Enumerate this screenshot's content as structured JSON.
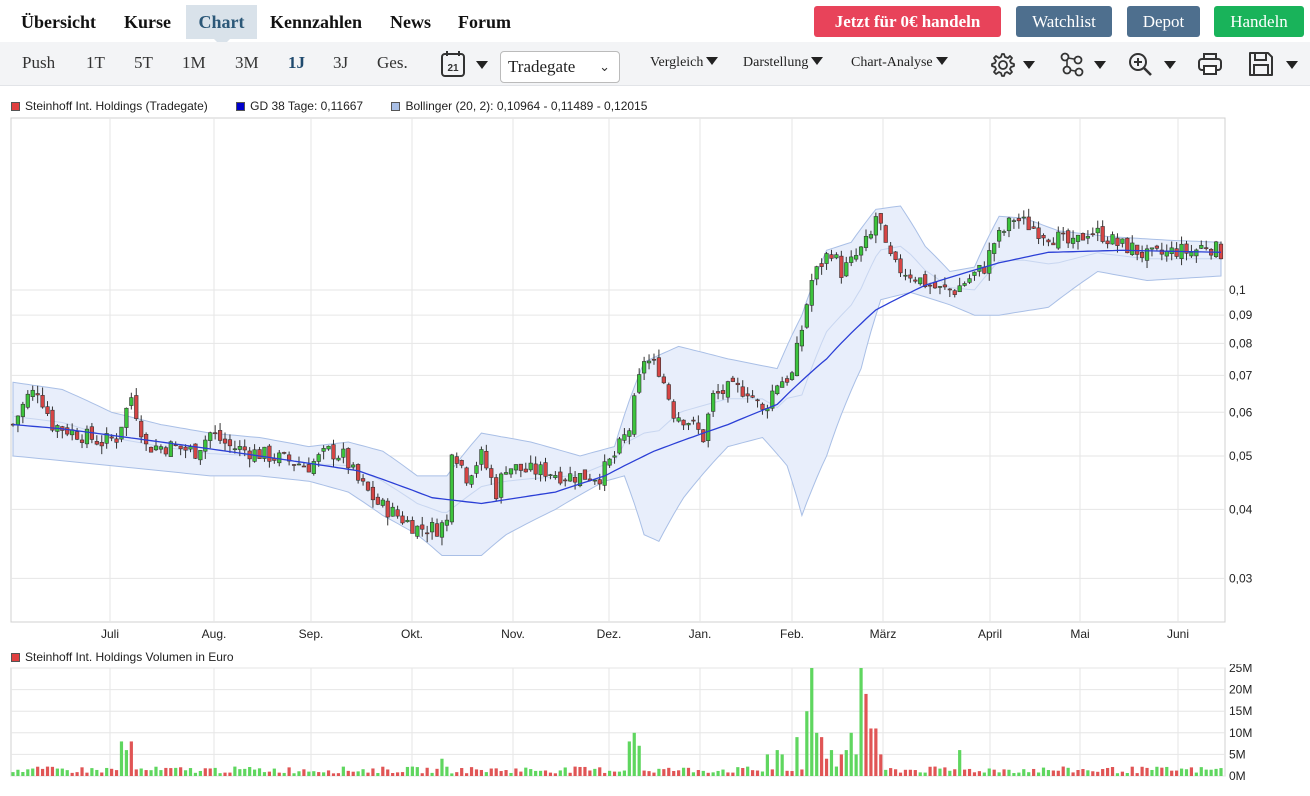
{
  "nav": {
    "tabs": [
      {
        "label": "Übersicht",
        "active": false
      },
      {
        "label": "Kurse",
        "active": false
      },
      {
        "label": "Chart",
        "active": true
      },
      {
        "label": "Kennzahlen",
        "active": false
      },
      {
        "label": "News",
        "active": false
      },
      {
        "label": "Forum",
        "active": false
      }
    ],
    "buttons": {
      "trade_now": "Jetzt für 0€ handeln",
      "watchlist": "Watchlist",
      "depot": "Depot",
      "handeln": "Handeln"
    }
  },
  "toolbar": {
    "timeframes": [
      {
        "label": "Push",
        "active": false
      },
      {
        "label": "1T",
        "active": false
      },
      {
        "label": "5T",
        "active": false
      },
      {
        "label": "1M",
        "active": false
      },
      {
        "label": "3M",
        "active": false
      },
      {
        "label": "1J",
        "active": true
      },
      {
        "label": "3J",
        "active": false
      },
      {
        "label": "Ges.",
        "active": false
      }
    ],
    "calendar_day": "21",
    "exchange_select": "Tradegate",
    "menus": {
      "compare": "Vergleich",
      "display": "Darstellung",
      "analysis": "Chart-Analyse"
    },
    "icons": [
      "calendar-icon",
      "settings-icon",
      "indicators-icon",
      "zoom-in-icon",
      "print-icon",
      "save-icon"
    ]
  },
  "legend_price": [
    {
      "label": "Steinhoff Int. Holdings (Tradegate)",
      "color": "#e04040"
    },
    {
      "label": "GD 38 Tage: 0,11667",
      "color": "#0000cc"
    },
    {
      "label": "Bollinger (20, 2): 0,10964 - 0,11489 - 0,12015",
      "color": "#a9bfe6"
    }
  ],
  "legend_volume": {
    "label": "Steinhoff Int. Holdings Volumen in Euro",
    "color": "#e04040"
  },
  "chart_data": [
    {
      "type": "candlestick",
      "scale": "log",
      "x_ticks": [
        "Juli",
        "Aug.",
        "Sep.",
        "Okt.",
        "Nov.",
        "Dez.",
        "Jan.",
        "Feb.",
        "März",
        "April",
        "Mai",
        "Juni"
      ],
      "y_ticks": [
        "0,03",
        "0,04",
        "0,05",
        "0,06",
        "0,07",
        "0,08",
        "0,09",
        "0,1"
      ],
      "y_tick_values": [
        0.03,
        0.04,
        0.05,
        0.06,
        0.07,
        0.08,
        0.09,
        0.1
      ],
      "ylim": [
        0.025,
        0.205
      ],
      "start_month": "Juni",
      "close_path": [
        [
          0,
          0.057
        ],
        [
          3,
          0.064
        ],
        [
          5,
          0.066
        ],
        [
          8,
          0.057
        ],
        [
          13,
          0.055
        ],
        [
          18,
          0.053
        ],
        [
          21,
          0.054
        ],
        [
          24,
          0.064
        ],
        [
          27,
          0.052
        ],
        [
          32,
          0.052
        ],
        [
          37,
          0.051
        ],
        [
          40,
          0.055
        ],
        [
          44,
          0.052
        ],
        [
          48,
          0.051
        ],
        [
          52,
          0.05
        ],
        [
          56,
          0.049
        ],
        [
          60,
          0.048
        ],
        [
          64,
          0.051
        ],
        [
          67,
          0.05
        ],
        [
          70,
          0.045
        ],
        [
          74,
          0.041
        ],
        [
          78,
          0.039
        ],
        [
          82,
          0.037
        ],
        [
          86,
          0.037
        ],
        [
          88,
          0.038
        ],
        [
          89,
          0.052
        ],
        [
          92,
          0.046
        ],
        [
          95,
          0.05
        ],
        [
          98,
          0.043
        ],
        [
          100,
          0.048
        ],
        [
          104,
          0.047
        ],
        [
          108,
          0.047
        ],
        [
          112,
          0.046
        ],
        [
          116,
          0.046
        ],
        [
          119,
          0.046
        ],
        [
          122,
          0.05
        ],
        [
          125,
          0.056
        ],
        [
          128,
          0.075
        ],
        [
          131,
          0.072
        ],
        [
          134,
          0.06
        ],
        [
          137,
          0.058
        ],
        [
          140,
          0.054
        ],
        [
          142,
          0.064
        ],
        [
          145,
          0.066
        ],
        [
          149,
          0.066
        ],
        [
          152,
          0.06
        ],
        [
          155,
          0.068
        ],
        [
          158,
          0.07
        ],
        [
          160,
          0.085
        ],
        [
          162,
          0.104
        ],
        [
          164,
          0.112
        ],
        [
          166,
          0.118
        ],
        [
          168,
          0.108
        ],
        [
          170,
          0.112
        ],
        [
          172,
          0.118
        ],
        [
          174,
          0.125
        ],
        [
          175,
          0.136
        ],
        [
          176,
          0.13
        ],
        [
          177,
          0.118
        ],
        [
          179,
          0.11
        ],
        [
          182,
          0.107
        ],
        [
          185,
          0.103
        ],
        [
          188,
          0.1
        ],
        [
          191,
          0.1
        ],
        [
          194,
          0.105
        ],
        [
          197,
          0.11
        ],
        [
          199,
          0.122
        ],
        [
          201,
          0.128
        ],
        [
          203,
          0.135
        ],
        [
          206,
          0.131
        ],
        [
          209,
          0.127
        ],
        [
          212,
          0.124
        ],
        [
          215,
          0.12
        ],
        [
          218,
          0.128
        ],
        [
          221,
          0.126
        ],
        [
          224,
          0.121
        ],
        [
          227,
          0.119
        ],
        [
          230,
          0.115
        ],
        [
          233,
          0.116
        ],
        [
          236,
          0.118
        ],
        [
          239,
          0.117
        ],
        [
          242,
          0.121
        ],
        [
          245,
          0.117
        ]
      ],
      "sma38": [
        [
          0,
          0.057
        ],
        [
          10,
          0.056
        ],
        [
          30,
          0.053
        ],
        [
          50,
          0.05
        ],
        [
          70,
          0.047
        ],
        [
          85,
          0.042
        ],
        [
          95,
          0.041
        ],
        [
          110,
          0.043
        ],
        [
          120,
          0.046
        ],
        [
          130,
          0.051
        ],
        [
          145,
          0.057
        ],
        [
          155,
          0.062
        ],
        [
          165,
          0.075
        ],
        [
          175,
          0.092
        ],
        [
          185,
          0.102
        ],
        [
          200,
          0.112
        ],
        [
          210,
          0.117
        ],
        [
          225,
          0.118
        ],
        [
          245,
          0.117
        ]
      ],
      "bollinger_upper": [
        [
          0,
          0.068
        ],
        [
          10,
          0.066
        ],
        [
          20,
          0.06
        ],
        [
          30,
          0.057
        ],
        [
          40,
          0.055
        ],
        [
          50,
          0.054
        ],
        [
          60,
          0.052
        ],
        [
          68,
          0.053
        ],
        [
          75,
          0.051
        ],
        [
          82,
          0.046
        ],
        [
          88,
          0.046
        ],
        [
          95,
          0.055
        ],
        [
          105,
          0.053
        ],
        [
          115,
          0.05
        ],
        [
          122,
          0.052
        ],
        [
          128,
          0.074
        ],
        [
          135,
          0.079
        ],
        [
          145,
          0.075
        ],
        [
          155,
          0.072
        ],
        [
          160,
          0.09
        ],
        [
          165,
          0.118
        ],
        [
          170,
          0.122
        ],
        [
          175,
          0.14
        ],
        [
          180,
          0.142
        ],
        [
          185,
          0.12
        ],
        [
          190,
          0.108
        ],
        [
          195,
          0.11
        ],
        [
          200,
          0.136
        ],
        [
          205,
          0.135
        ],
        [
          212,
          0.128
        ],
        [
          222,
          0.125
        ],
        [
          235,
          0.123
        ],
        [
          245,
          0.122
        ]
      ],
      "bollinger_lower": [
        [
          0,
          0.05
        ],
        [
          10,
          0.049
        ],
        [
          20,
          0.048
        ],
        [
          30,
          0.047
        ],
        [
          40,
          0.046
        ],
        [
          50,
          0.046
        ],
        [
          60,
          0.045
        ],
        [
          68,
          0.043
        ],
        [
          75,
          0.039
        ],
        [
          82,
          0.036
        ],
        [
          87,
          0.033
        ],
        [
          95,
          0.033
        ],
        [
          100,
          0.036
        ],
        [
          110,
          0.04
        ],
        [
          120,
          0.045
        ],
        [
          124,
          0.046
        ],
        [
          128,
          0.036
        ],
        [
          131,
          0.035
        ],
        [
          136,
          0.042
        ],
        [
          145,
          0.052
        ],
        [
          152,
          0.054
        ],
        [
          157,
          0.048
        ],
        [
          160,
          0.039
        ],
        [
          165,
          0.05
        ],
        [
          172,
          0.072
        ],
        [
          176,
          0.096
        ],
        [
          182,
          0.099
        ],
        [
          190,
          0.094
        ],
        [
          195,
          0.09
        ],
        [
          200,
          0.09
        ],
        [
          210,
          0.093
        ],
        [
          220,
          0.108
        ],
        [
          230,
          0.104
        ],
        [
          245,
          0.106
        ]
      ]
    },
    {
      "type": "bar",
      "y_ticks": [
        "0M",
        "5M",
        "10M",
        "15M",
        "20M",
        "25M"
      ],
      "ylim": [
        0,
        25
      ],
      "unit": "M",
      "peaks": [
        [
          22,
          8,
          "green"
        ],
        [
          23,
          6,
          "green"
        ],
        [
          24,
          8,
          "red"
        ],
        [
          87,
          4,
          "green"
        ],
        [
          125,
          8,
          "green"
        ],
        [
          126,
          10,
          "green"
        ],
        [
          127,
          7,
          "green"
        ],
        [
          153,
          5,
          "green"
        ],
        [
          155,
          6,
          "green"
        ],
        [
          156,
          5,
          "green"
        ],
        [
          159,
          9,
          "green"
        ],
        [
          161,
          15,
          "green"
        ],
        [
          162,
          25,
          "green"
        ],
        [
          163,
          10,
          "green"
        ],
        [
          164,
          9,
          "red"
        ],
        [
          165,
          4,
          "red"
        ],
        [
          166,
          6,
          "green"
        ],
        [
          168,
          5,
          "red"
        ],
        [
          169,
          6,
          "green"
        ],
        [
          170,
          10,
          "green"
        ],
        [
          171,
          5,
          "green"
        ],
        [
          172,
          25,
          "green"
        ],
        [
          173,
          19,
          "red"
        ],
        [
          174,
          11,
          "red"
        ],
        [
          175,
          11,
          "red"
        ],
        [
          176,
          5,
          "red"
        ],
        [
          192,
          6,
          "green"
        ]
      ]
    }
  ]
}
